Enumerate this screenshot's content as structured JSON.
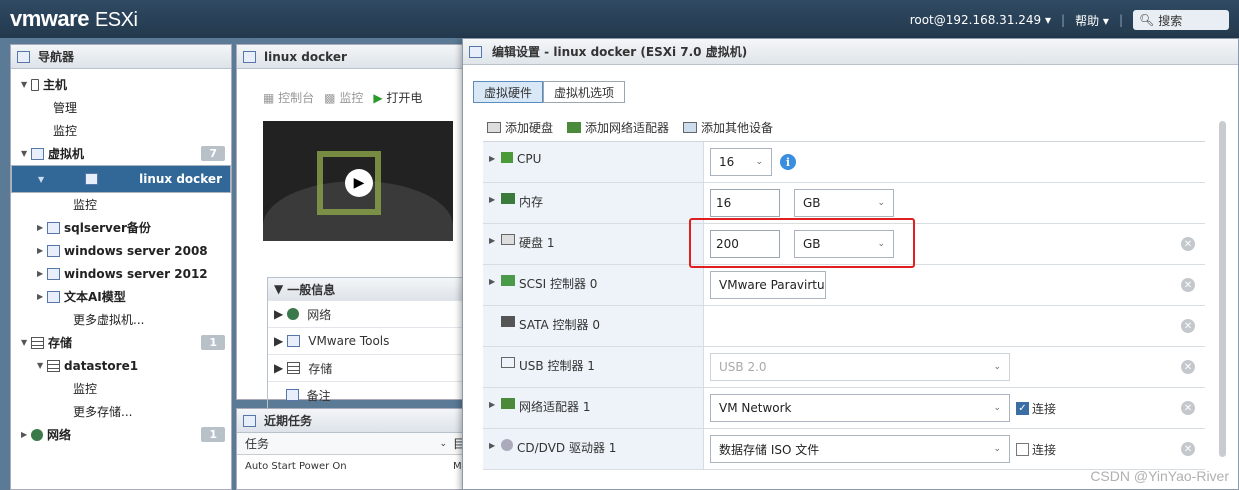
{
  "topbar": {
    "brand_bold": "vmware",
    "brand_product": "ESXi",
    "user": "root@192.168.31.249",
    "help": "帮助",
    "search_placeholder": "搜索"
  },
  "navigator": {
    "title": "导航器",
    "items": [
      {
        "label": "主机",
        "level": 0
      },
      {
        "label": "管理",
        "level": 1
      },
      {
        "label": "监控",
        "level": 1
      },
      {
        "label": "虚拟机",
        "level": 0,
        "badge": "7"
      },
      {
        "label": "linux docker",
        "level": 1,
        "selected": true
      },
      {
        "label": "监控",
        "level": 2
      },
      {
        "label": "sqlserver备份",
        "level": 1
      },
      {
        "label": "windows server 2008",
        "level": 1
      },
      {
        "label": "windows server 2012",
        "level": 1
      },
      {
        "label": "文本AI模型",
        "level": 1
      },
      {
        "label": "更多虚拟机...",
        "level": 2
      },
      {
        "label": "存储",
        "level": 0,
        "badge": "1"
      },
      {
        "label": "datastore1",
        "level": 1
      },
      {
        "label": "监控",
        "level": 2
      },
      {
        "label": "更多存储...",
        "level": 2
      },
      {
        "label": "网络",
        "level": 0,
        "badge": "1"
      }
    ]
  },
  "vm_panel": {
    "title": "linux docker",
    "toolbar": {
      "console": "控制台",
      "monitor": "监控",
      "power_on": "打开电"
    },
    "general": {
      "header": "一般信息",
      "rows": [
        "网络",
        "VMware Tools",
        "存储",
        "备注"
      ]
    }
  },
  "tasks": {
    "title": "近期任务",
    "col_task": "任务",
    "col_target": "目",
    "rows": [
      {
        "task": "Auto Start Power On",
        "target": "M"
      }
    ]
  },
  "dialog": {
    "title": "编辑设置 - linux docker (ESXi 7.0 虚拟机)",
    "tabs": {
      "hardware": "虚拟硬件",
      "options": "虚拟机选项"
    },
    "actions": {
      "add_disk": "添加硬盘",
      "add_nic": "添加网络适配器",
      "add_other": "添加其他设备"
    },
    "hardware": {
      "cpu": {
        "label": "CPU",
        "value": "16"
      },
      "memory": {
        "label": "内存",
        "value": "16",
        "unit": "GB"
      },
      "disk1": {
        "label": "硬盘 1",
        "value": "200",
        "unit": "GB"
      },
      "scsi": {
        "label": "SCSI 控制器 0",
        "value": "VMware Paravirtual"
      },
      "sata": {
        "label": "SATA 控制器 0"
      },
      "usb": {
        "label": "USB 控制器 1",
        "value": "USB 2.0"
      },
      "nic1": {
        "label": "网络适配器 1",
        "value": "VM Network",
        "connect": "连接",
        "connected": true
      },
      "cdrom1": {
        "label": "CD/DVD 驱动器 1",
        "value": "数据存储 ISO 文件",
        "connect": "连接",
        "connected": false
      }
    }
  },
  "watermark": "CSDN @YinYao-River",
  "colors": {
    "selected": "#316898",
    "highlight": "#e02020",
    "topbar": "#2f4a63"
  }
}
